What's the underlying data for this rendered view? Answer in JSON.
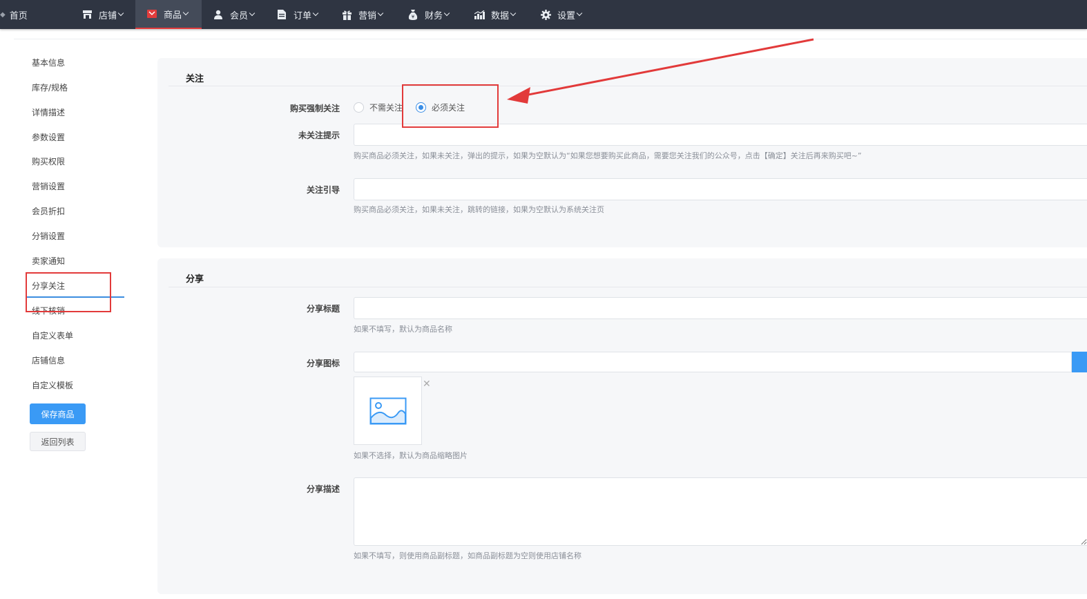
{
  "topnav": {
    "items": [
      {
        "label": "首页",
        "icon": "home-icon"
      },
      {
        "label": "店铺",
        "icon": "store-icon"
      },
      {
        "label": "商品",
        "icon": "goods-icon"
      },
      {
        "label": "会员",
        "icon": "user-icon"
      },
      {
        "label": "订单",
        "icon": "order-icon"
      },
      {
        "label": "营销",
        "icon": "gift-icon"
      },
      {
        "label": "财务",
        "icon": "money-bag-icon"
      },
      {
        "label": "数据",
        "icon": "bar-chart-icon"
      },
      {
        "label": "设置",
        "icon": "gear-icon"
      }
    ],
    "active": "商品"
  },
  "sidebar": {
    "items": [
      {
        "label": "基本信息"
      },
      {
        "label": "库存/规格"
      },
      {
        "label": "详情描述"
      },
      {
        "label": "参数设置"
      },
      {
        "label": "购买权限"
      },
      {
        "label": "营销设置"
      },
      {
        "label": "会员折扣"
      },
      {
        "label": "分销设置"
      },
      {
        "label": "卖家通知"
      },
      {
        "label": "分享关注"
      },
      {
        "label": "线下核销"
      },
      {
        "label": "自定义表单"
      },
      {
        "label": "店铺信息"
      },
      {
        "label": "自定义模板"
      }
    ],
    "active": "分享关注",
    "save_label": "保存商品",
    "back_label": "返回列表"
  },
  "follow": {
    "title": "关注",
    "force_label": "购买强制关注",
    "options": [
      {
        "label": "不需关注",
        "checked": false
      },
      {
        "label": "必须关注",
        "checked": true
      }
    ],
    "tip_label": "未关注提示",
    "tip_value": "",
    "tip_help": "购买商品必须关注，如果未关注，弹出的提示，如果为空默认为“如果您想要购买此商品，需要您关注我们的公众号，点击【确定】关注后再来购买吧~”",
    "guide_label": "关注引导",
    "guide_value": "",
    "guide_help": "购买商品必须关注，如果未关注，跳转的链接，如果为空默认为系统关注页"
  },
  "share": {
    "title": "分享",
    "title_label": "分享标题",
    "title_value": "",
    "title_help": "如果不填写，默认为商品名称",
    "icon_label": "分享图标",
    "icon_value": "",
    "icon_help": "如果不选择，默认为商品缩略图片",
    "desc_label": "分享描述",
    "desc_value": "",
    "desc_help": "如果不填写，则使用商品副标题，如商品副标题为空则使用店铺名称"
  },
  "colors": {
    "nav_bg": "#2f3542",
    "accent_blue": "#3a9af5",
    "annotation_red": "#e23a3a"
  }
}
